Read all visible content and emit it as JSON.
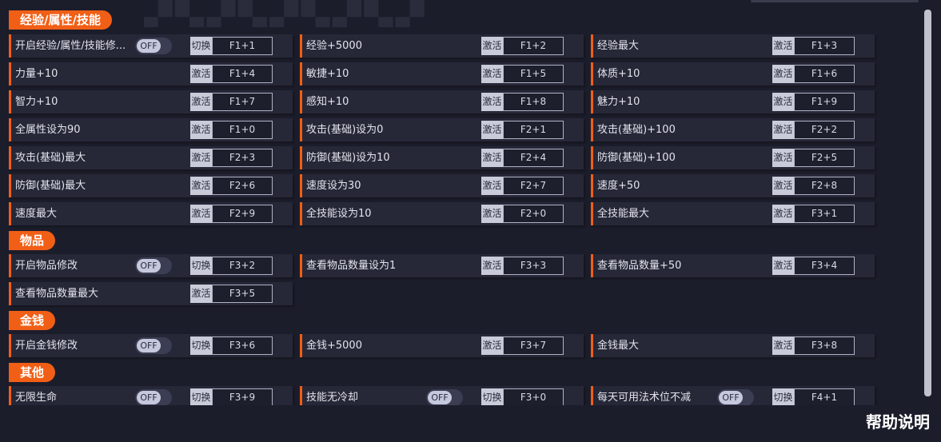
{
  "sections": [
    {
      "title": "经验/属性/技能",
      "rows": [
        [
          {
            "label": "开启经验/属性/技能修...",
            "toggle": "OFF",
            "action": "切换",
            "key": "F1+1"
          },
          {
            "label": "经验+5000",
            "action": "激活",
            "key": "F1+2"
          },
          {
            "label": "经验最大",
            "action": "激活",
            "key": "F1+3"
          }
        ],
        [
          {
            "label": "力量+10",
            "action": "激活",
            "key": "F1+4"
          },
          {
            "label": "敏捷+10",
            "action": "激活",
            "key": "F1+5"
          },
          {
            "label": "体质+10",
            "action": "激活",
            "key": "F1+6"
          }
        ],
        [
          {
            "label": "智力+10",
            "action": "激活",
            "key": "F1+7"
          },
          {
            "label": "感知+10",
            "action": "激活",
            "key": "F1+8"
          },
          {
            "label": "魅力+10",
            "action": "激活",
            "key": "F1+9"
          }
        ],
        [
          {
            "label": "全属性设为90",
            "action": "激活",
            "key": "F1+0"
          },
          {
            "label": "攻击(基础)设为0",
            "action": "激活",
            "key": "F2+1"
          },
          {
            "label": "攻击(基础)+100",
            "action": "激活",
            "key": "F2+2"
          }
        ],
        [
          {
            "label": "攻击(基础)最大",
            "action": "激活",
            "key": "F2+3"
          },
          {
            "label": "防御(基础)设为10",
            "action": "激活",
            "key": "F2+4"
          },
          {
            "label": "防御(基础)+100",
            "action": "激活",
            "key": "F2+5"
          }
        ],
        [
          {
            "label": "防御(基础)最大",
            "action": "激活",
            "key": "F2+6"
          },
          {
            "label": "速度设为30",
            "action": "激活",
            "key": "F2+7"
          },
          {
            "label": "速度+50",
            "action": "激活",
            "key": "F2+8"
          }
        ],
        [
          {
            "label": "速度最大",
            "action": "激活",
            "key": "F2+9"
          },
          {
            "label": "全技能设为10",
            "action": "激活",
            "key": "F2+0"
          },
          {
            "label": "全技能最大",
            "action": "激活",
            "key": "F3+1"
          }
        ]
      ]
    },
    {
      "title": "物品",
      "rows": [
        [
          {
            "label": "开启物品修改",
            "toggle": "OFF",
            "action": "切换",
            "key": "F3+2"
          },
          {
            "label": "查看物品数量设为1",
            "action": "激活",
            "key": "F3+3"
          },
          {
            "label": "查看物品数量+50",
            "action": "激活",
            "key": "F3+4"
          }
        ],
        [
          {
            "label": "查看物品数量最大",
            "action": "激活",
            "key": "F3+5"
          }
        ]
      ]
    },
    {
      "title": "金钱",
      "rows": [
        [
          {
            "label": "开启金钱修改",
            "toggle": "OFF",
            "action": "切换",
            "key": "F3+6"
          },
          {
            "label": "金钱+5000",
            "action": "激活",
            "key": "F3+7"
          },
          {
            "label": "金钱最大",
            "action": "激活",
            "key": "F3+8"
          }
        ]
      ]
    },
    {
      "title": "其他",
      "rows": [
        [
          {
            "label": "无限生命",
            "toggle": "OFF",
            "action": "切换",
            "key": "F3+9"
          },
          {
            "label": "技能无冷却",
            "toggle": "OFF",
            "action": "切换",
            "key": "F3+0"
          },
          {
            "label": "每天可用法术位不减",
            "toggle": "OFF",
            "action": "切换",
            "key": "F4+1"
          }
        ]
      ]
    }
  ],
  "help_label": "帮助说明",
  "colors": {
    "accent": "#f15f16",
    "background": "#1c1d2b",
    "row": "#262838"
  }
}
